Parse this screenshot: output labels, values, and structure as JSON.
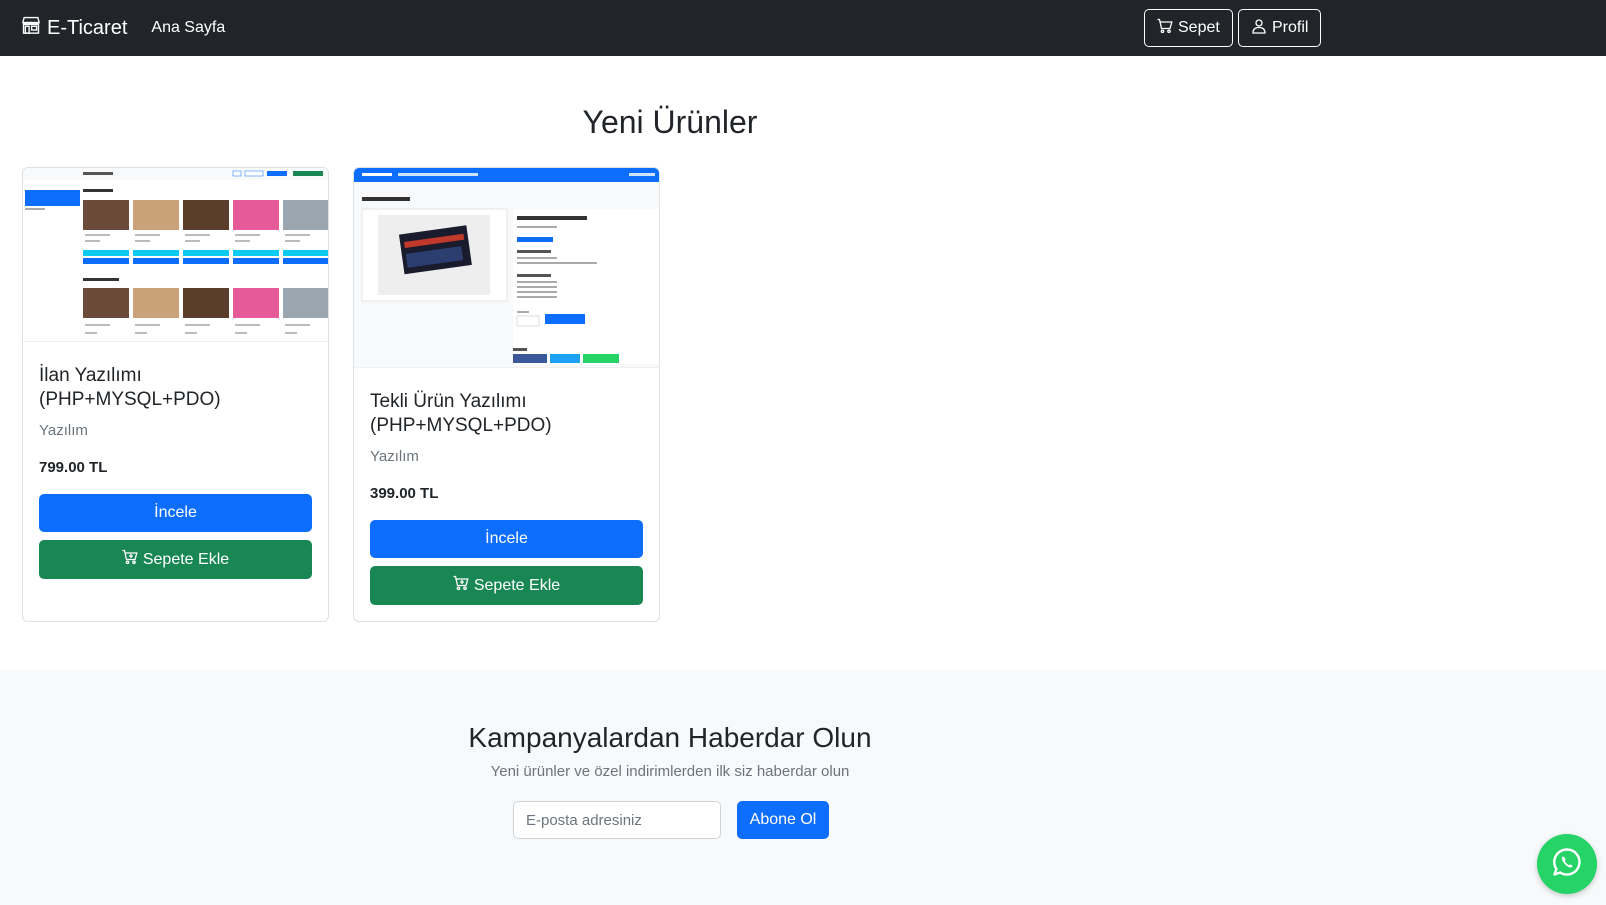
{
  "navbar": {
    "brand": "E-Ticaret",
    "home_link": "Ana Sayfa",
    "cart_button": "Sepet",
    "profile_button": "Profil"
  },
  "section": {
    "title": "Yeni Ürünler"
  },
  "products": [
    {
      "title_line1": "İlan Yazılımı",
      "title_line2": "(PHP+MYSQL+PDO)",
      "category": "Yazılım",
      "price": "799.00 TL",
      "view_button": "İncele",
      "add_button": "Sepete Ekle"
    },
    {
      "title_line1": "Tekli Ürün Yazılımı",
      "title_line2": "(PHP+MYSQL+PDO)",
      "category": "Yazılım",
      "price": "399.00 TL",
      "view_button": "İncele",
      "add_button": "Sepete Ekle"
    }
  ],
  "newsletter": {
    "title": "Kampanyalardan Haberdar Olun",
    "subtitle": "Yeni ürünler ve özel indirimlerden ilk siz haberdar olun",
    "email_placeholder": "E-posta adresiniz",
    "subscribe_button": "Abone Ol"
  },
  "colors": {
    "navbar_bg": "#212529",
    "primary": "#0d6efd",
    "success": "#198754",
    "whatsapp": "#25d366"
  },
  "icons": [
    "shop-icon",
    "cart-icon",
    "person-icon",
    "cart-plus-icon",
    "whatsapp-icon"
  ]
}
